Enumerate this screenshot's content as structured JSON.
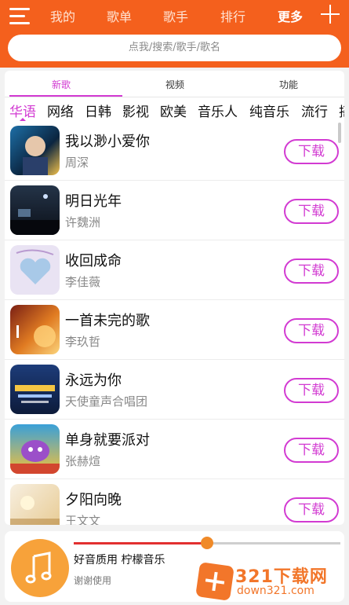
{
  "colors": {
    "brand": "#f4601d",
    "accent": "#d23bd2",
    "progress": "#e23030",
    "knob": "#f08a28",
    "disc": "#f7a23a"
  },
  "nav": {
    "items": [
      "我的",
      "歌单",
      "歌手",
      "排行",
      "更多"
    ],
    "active_index": 4,
    "menu_icon": "hamburger-menu-icon",
    "add_icon": "plus-icon"
  },
  "search": {
    "placeholder": "点我/搜索/歌手/歌名"
  },
  "tabs": {
    "items": [
      "新歌",
      "视频",
      "功能"
    ],
    "active_index": 0
  },
  "categories": {
    "items": [
      "华语",
      "网络",
      "日韩",
      "影视",
      "欧美",
      "音乐人",
      "纯音乐",
      "流行",
      "摇"
    ],
    "active_index": 0
  },
  "songs": [
    {
      "title": "我以渺小爱你",
      "artist": "周深",
      "action": "下载"
    },
    {
      "title": "明日光年",
      "artist": "许魏洲",
      "action": "下载"
    },
    {
      "title": "收回成命",
      "artist": "李佳薇",
      "action": "下载"
    },
    {
      "title": "一首未完的歌",
      "artist": "李玖哲",
      "action": "下载"
    },
    {
      "title": "永远为你",
      "artist": "天使童声合唱团",
      "action": "下载"
    },
    {
      "title": "单身就要派对",
      "artist": "张赫煊",
      "action": "下载"
    },
    {
      "title": "夕阳向晚",
      "artist": "王文文",
      "action": "下载"
    }
  ],
  "player": {
    "title": "好音质用 柠檬音乐",
    "subtitle": "谢谢使用",
    "progress": 0.5,
    "icon": "music-note-icon"
  },
  "watermark": {
    "main": "321下载网",
    "sub": "down321.com"
  }
}
